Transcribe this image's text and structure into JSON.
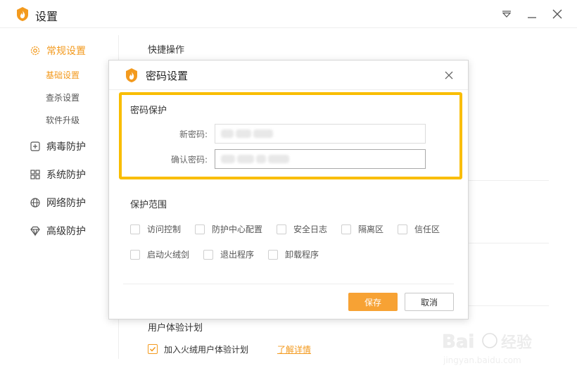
{
  "window": {
    "title": "设置"
  },
  "sidebar": {
    "groups": [
      {
        "label": "常规设置",
        "icon": "gear-icon"
      },
      {
        "label": "病毒防护",
        "icon": "plus-square-icon"
      },
      {
        "label": "系统防护",
        "icon": "grid-icon"
      },
      {
        "label": "网络防护",
        "icon": "globe-icon"
      },
      {
        "label": "高级防护",
        "icon": "diamond-icon"
      }
    ],
    "subitems": [
      {
        "label": "基础设置"
      },
      {
        "label": "查杀设置"
      },
      {
        "label": "软件升级"
      }
    ]
  },
  "background": {
    "section_quick": "快捷操作",
    "section_ux": "用户体验计划",
    "ux_checkbox_label": "加入火绒用户体验计划",
    "ux_checked": true,
    "ux_link": "了解详情"
  },
  "dialog": {
    "title": "密码设置",
    "password_section_title": "密码保护",
    "new_password_label": "新密码:",
    "confirm_password_label": "确认密码:",
    "scope_section_title": "保护范围",
    "scope_options": [
      {
        "label": "访问控制",
        "checked": false
      },
      {
        "label": "防护中心配置",
        "checked": false
      },
      {
        "label": "安全日志",
        "checked": false
      },
      {
        "label": "隔离区",
        "checked": false
      },
      {
        "label": "信任区",
        "checked": false
      },
      {
        "label": "启动火绒剑",
        "checked": false
      },
      {
        "label": "退出程序",
        "checked": false
      },
      {
        "label": "卸载程序",
        "checked": false
      }
    ],
    "save_label": "保存",
    "cancel_label": "取消"
  },
  "colors": {
    "accent": "#f39a1e",
    "highlight_border": "#f9bd00",
    "save_button": "#f7a234"
  }
}
